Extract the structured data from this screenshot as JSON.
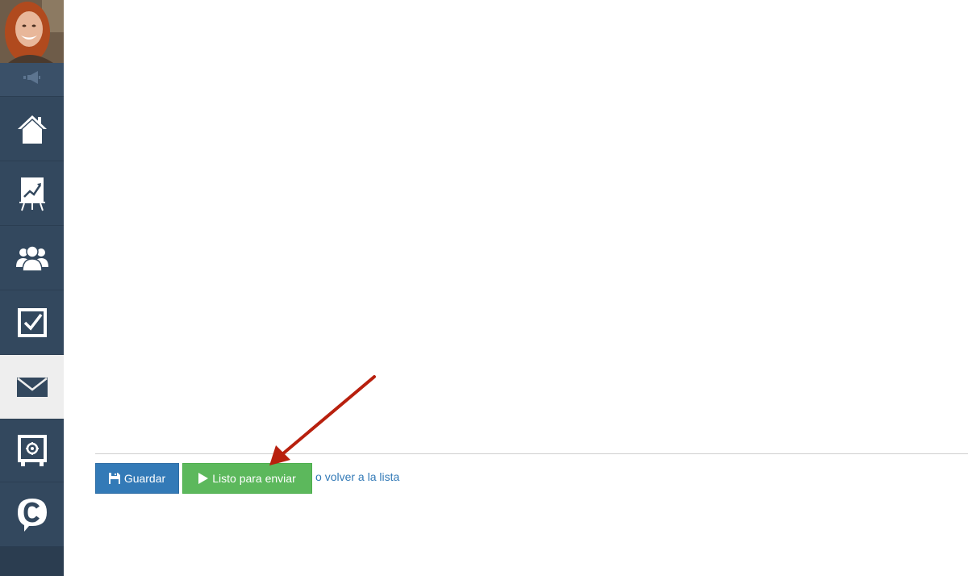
{
  "sidebar": {
    "avatar": "user-photo",
    "notify_icon": "megaphone-icon",
    "items": [
      {
        "icon": "home-icon",
        "active": false
      },
      {
        "icon": "chart-board-icon",
        "active": false
      },
      {
        "icon": "users-group-icon",
        "active": false
      },
      {
        "icon": "checkbox-icon",
        "active": false
      },
      {
        "icon": "envelope-icon",
        "active": true
      },
      {
        "icon": "safe-icon",
        "active": false
      },
      {
        "icon": "chat-c-icon",
        "active": false
      }
    ]
  },
  "actions": {
    "save_label": "Guardar",
    "send_label": "Listo para enviar",
    "or_text": "o",
    "back_link": "volver a la lista"
  },
  "colors": {
    "sidebar": "#33485e",
    "primary": "#337ab7",
    "success": "#5cb85c",
    "annotation_arrow": "#b8200e"
  }
}
